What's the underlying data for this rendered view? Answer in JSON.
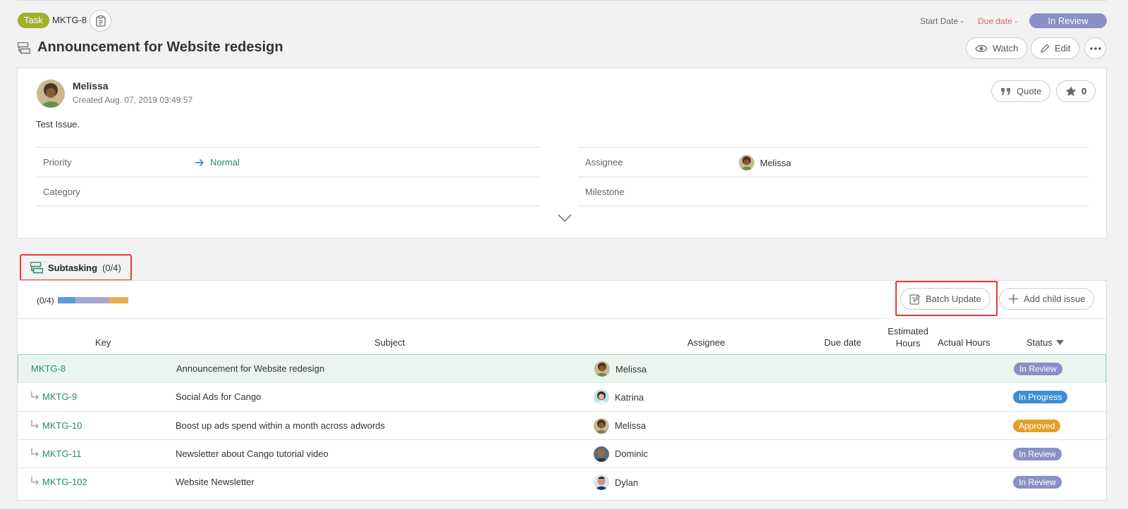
{
  "header": {
    "type_badge": "Task",
    "issue_key": "MKTG-8",
    "start_date_label": "Start Date",
    "start_date_value": "-",
    "due_date_label": "Due date",
    "due_date_value": "-",
    "status": "In Review",
    "title": "Announcement for Website redesign",
    "watch_label": "Watch",
    "edit_label": "Edit"
  },
  "issue": {
    "author": "Melissa",
    "created": "Created  Aug. 07, 2019 03:49:57",
    "description": "Test Issue.",
    "quote_label": "Quote",
    "star_count": "0",
    "fields": {
      "priority_label": "Priority",
      "priority_value": "Normal",
      "assignee_label": "Assignee",
      "assignee_value": "Melissa",
      "category_label": "Category",
      "milestone_label": "Milestone"
    }
  },
  "subtasking": {
    "label": "Subtasking",
    "count": "(0/4)",
    "progress_text": "(0/4)",
    "progress_segments": [
      {
        "color": "#5b9bd5",
        "fraction": 0.25
      },
      {
        "color": "#a3a7d1",
        "fraction": 0.47
      },
      {
        "color": "#e8b04a",
        "fraction": 0.28
      }
    ],
    "batch_update_label": "Batch Update",
    "add_child_label": "Add child issue",
    "columns": {
      "key": "Key",
      "subject": "Subject",
      "assignee": "Assignee",
      "due_date": "Due date",
      "estimated_hours": "Estimated Hours",
      "actual_hours": "Actual Hours",
      "status": "Status"
    },
    "rows": [
      {
        "key": "MKTG-8",
        "subject": "Announcement for Website redesign",
        "assignee": "Melissa",
        "status": "In Review",
        "status_color": "#8a8fc4"
      },
      {
        "key": "MKTG-9",
        "subject": "Social Ads for Cango",
        "assignee": "Katrina",
        "status": "In Progress",
        "status_color": "#3d8ed4"
      },
      {
        "key": "MKTG-10",
        "subject": "Boost up ads spend within a month across adwords",
        "assignee": "Melissa",
        "status": "Approved",
        "status_color": "#e0a02a"
      },
      {
        "key": "MKTG-11",
        "subject": "Newsletter about Cango tutorial video",
        "assignee": "Dominic",
        "status": "In Review",
        "status_color": "#8a8fc4"
      },
      {
        "key": "MKTG-102",
        "subject": "Website Newsletter",
        "assignee": "Dylan",
        "status": "In Review",
        "status_color": "#8a8fc4"
      }
    ]
  }
}
